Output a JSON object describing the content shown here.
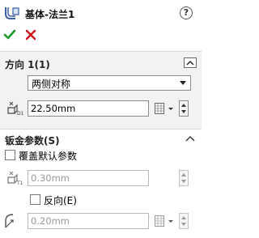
{
  "header": {
    "title": "基体-法兰1",
    "help_label": "?"
  },
  "direction1": {
    "title": "方向 1(1)",
    "end_condition": "两侧对称",
    "depth": {
      "value": "22.50mm",
      "icon_label": "D1"
    }
  },
  "sheet_metal": {
    "title": "钣金参数(S)",
    "override_default_label": "覆盖默认参数",
    "override_default_checked": false,
    "thickness": {
      "value": "0.30mm",
      "icon_label": "T1",
      "enabled": false
    },
    "reverse_label": "反向(E)",
    "reverse_checked": false,
    "bend_radius": {
      "value": "0.20mm",
      "enabled": false
    }
  },
  "colors": {
    "ok_green": "#1e9a2a",
    "cancel_red": "#d0131b",
    "section_bg": "#f2f2f2",
    "disabled_text": "#9a9a9a"
  }
}
